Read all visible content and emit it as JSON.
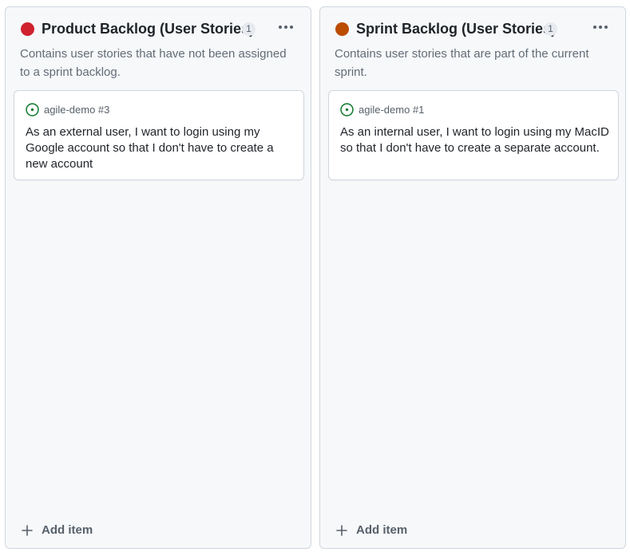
{
  "columns": [
    {
      "title": "Product Backlog (User Stories)",
      "count": "1",
      "status_color": "#cf222e",
      "description": "Contains user stories that have not been assigned to a sprint backlog.",
      "cards": [
        {
          "reference": "agile-demo #3",
          "text": "As an external user, I want to login using my Google account so that I don't have to create a new account",
          "icon": "issue-open-icon"
        }
      ],
      "add_item_label": "Add item"
    },
    {
      "title": "Sprint Backlog (User Stories)",
      "count": "1",
      "status_color": "#bc4c00",
      "description": "Contains user stories that are part of the current sprint.",
      "cards": [
        {
          "reference": "agile-demo #1",
          "text": "As an internal user, I want to login using my MacID so that I don't have to create a separate account.",
          "icon": "issue-open-icon"
        }
      ],
      "add_item_label": "Add item"
    }
  ],
  "colors": {
    "issue_open": "#1a7f37",
    "column_bg": "#f6f8fa",
    "border": "#d0d7de"
  }
}
